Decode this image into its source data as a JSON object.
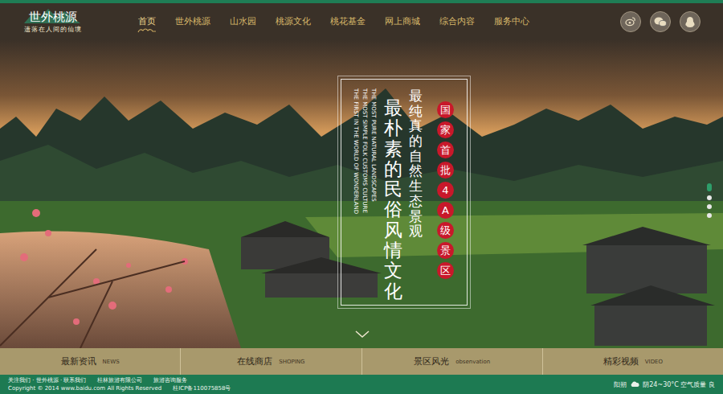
{
  "logo": {
    "title": "世外桃源",
    "tagline": "遗落在人间的仙境"
  },
  "nav": [
    {
      "label": "首页",
      "selected": true
    },
    {
      "label": "世外桃源",
      "selected": false
    },
    {
      "label": "山水园",
      "selected": false
    },
    {
      "label": "桃源文化",
      "selected": false
    },
    {
      "label": "桃花基金",
      "selected": false
    },
    {
      "label": "网上商城",
      "selected": false
    },
    {
      "label": "综合内容",
      "selected": false
    },
    {
      "label": "服务中心",
      "selected": false
    }
  ],
  "hero": {
    "badge": "国家首批4A级景区",
    "line1": "最纯真的自然生态景观",
    "line2": "最朴素的民俗风情文化",
    "english": [
      "THE MOST PURE NATURAL LANDSCAPES",
      "THE MOST SIMPLE FOLK CUSTOMS CULTURE",
      "THE FIRST IN THE WORLD OF WONDERLAND"
    ],
    "slides": [
      {
        "selected": true
      },
      {
        "selected": false
      },
      {
        "selected": false
      },
      {
        "selected": false
      }
    ]
  },
  "tabs": [
    {
      "label": "最新资讯",
      "sub": "NEWS"
    },
    {
      "label": "在线商店",
      "sub": "SHOPING"
    },
    {
      "label": "景区风光",
      "sub": "obsenvation"
    },
    {
      "label": "精彩视频",
      "sub": "VIDEO"
    }
  ],
  "footer": {
    "links": "关注我们 · 世外桃源 · 联系我们",
    "company": "桂林旅游有限公司",
    "service": "旅游咨询服务",
    "copyright": "Copyright © 2014 www.baidu.com All Rights Reserved",
    "icp": "桂ICP备110075858号",
    "city": "阳朔",
    "weather": "阴24~30°C 空气质量 良"
  }
}
